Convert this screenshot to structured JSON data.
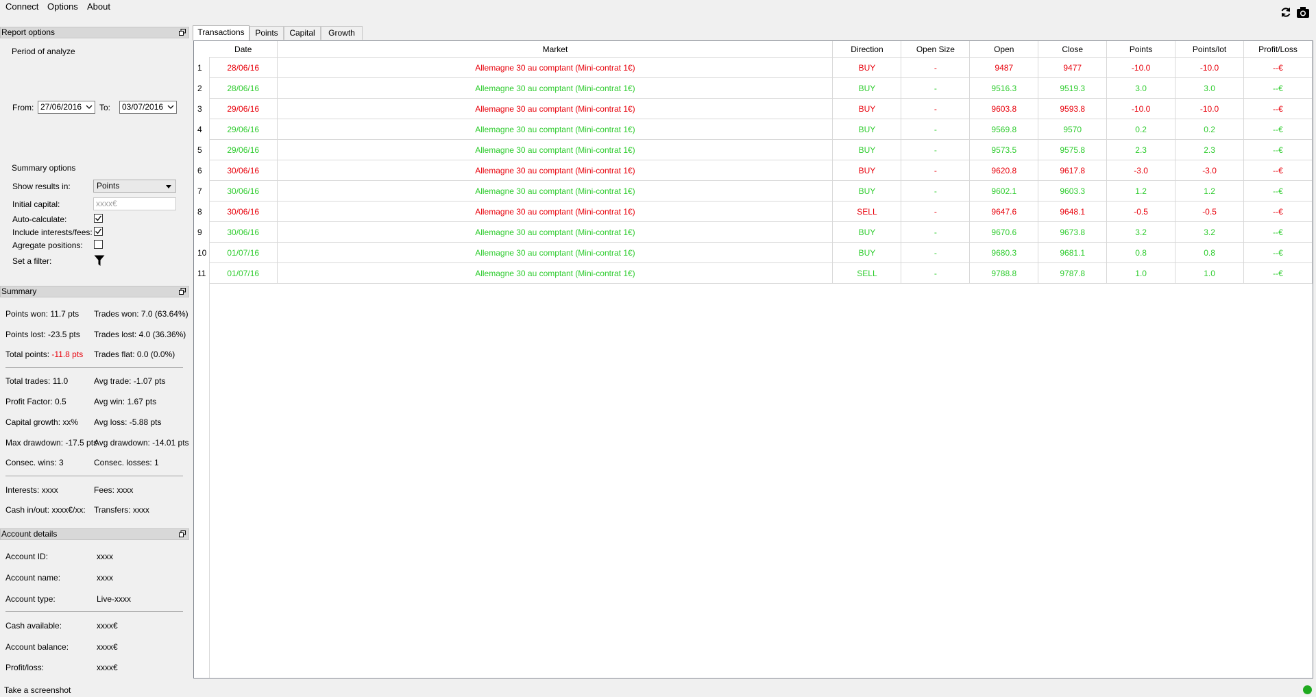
{
  "menu": {
    "items": [
      "Connect",
      "Options",
      "About"
    ]
  },
  "toolbar": {
    "refresh_icon": "refresh-icon",
    "screenshot_icon": "camera-icon"
  },
  "report_options": {
    "title": "Report options",
    "period_label": "Period of analyze",
    "from_label": "From:",
    "from_value": "27/06/2016",
    "to_label": "To:",
    "to_value": "03/07/2016",
    "summary_options_label": "Summary options",
    "show_results_label": "Show results in:",
    "show_results_value": "Points",
    "initial_capital_label": "Initial capital:",
    "initial_capital_placeholder": "xxxx€",
    "auto_calculate_label": "Auto-calculate:",
    "auto_calculate_checked": true,
    "include_fees_label": "Include interests/fees:",
    "include_fees_checked": true,
    "aggregate_label": "Agregate positions:",
    "aggregate_checked": false,
    "filter_label": "Set a filter:"
  },
  "summary": {
    "title": "Summary",
    "points_won": "Points won: 11.7 pts",
    "trades_won": "Trades won: 7.0 (63.64%)",
    "points_lost": "Points lost: -23.5 pts",
    "trades_lost": "Trades lost: 4.0 (36.36%)",
    "total_points_label": "Total points:",
    "total_points_value": "-11.8 pts",
    "trades_flat": "Trades flat: 0.0 (0.0%)",
    "total_trades": "Total trades: 11.0",
    "avg_trade": "Avg trade: -1.07 pts",
    "profit_factor": "Profit Factor: 0.5",
    "avg_win": "Avg win: 1.67 pts",
    "capital_growth": "Capital growth: xx%",
    "avg_loss": "Avg loss: -5.88 pts",
    "max_drawdown": "Max drawdown: -17.5 pts",
    "avg_drawdown": "Avg drawdown: -14.01 pts",
    "consec_wins": "Consec. wins: 3",
    "consec_losses": "Consec. losses: 1",
    "interests": "Interests: xxxx",
    "fees": "Fees: xxxx",
    "cash_in_out": "Cash in/out: xxxx€/xx:",
    "transfers": "Transfers: xxxx"
  },
  "account": {
    "title": "Account details",
    "id_label": "Account ID:",
    "id_value": "xxxx",
    "name_label": "Account name:",
    "name_value": "xxxx",
    "type_label": "Account type:",
    "type_value": "Live-xxxx",
    "cash_label": "Cash available:",
    "cash_value": "xxxx€",
    "balance_label": "Account balance:",
    "balance_value": "xxxx€",
    "pl_label": "Profit/loss:",
    "pl_value": "xxxx€"
  },
  "tabs": [
    "Transactions",
    "Points",
    "Capital",
    "Growth"
  ],
  "table": {
    "columns": [
      "Date",
      "Market",
      "Direction",
      "Open Size",
      "Open",
      "Close",
      "Points",
      "Points/lot",
      "Profit/Loss"
    ],
    "rows": [
      {
        "num": "1",
        "color": "red",
        "cells": [
          "28/06/16",
          "Allemagne 30 au comptant (Mini-contrat 1€)",
          "BUY",
          "-",
          "9487",
          "9477",
          "-10.0",
          "-10.0",
          "--€"
        ]
      },
      {
        "num": "2",
        "color": "green",
        "cells": [
          "28/06/16",
          "Allemagne 30 au comptant (Mini-contrat 1€)",
          "BUY",
          "-",
          "9516.3",
          "9519.3",
          "3.0",
          "3.0",
          "--€"
        ]
      },
      {
        "num": "3",
        "color": "red",
        "cells": [
          "29/06/16",
          "Allemagne 30 au comptant (Mini-contrat 1€)",
          "BUY",
          "-",
          "9603.8",
          "9593.8",
          "-10.0",
          "-10.0",
          "--€"
        ]
      },
      {
        "num": "4",
        "color": "green",
        "cells": [
          "29/06/16",
          "Allemagne 30 au comptant (Mini-contrat 1€)",
          "BUY",
          "-",
          "9569.8",
          "9570",
          "0.2",
          "0.2",
          "--€"
        ]
      },
      {
        "num": "5",
        "color": "green",
        "cells": [
          "29/06/16",
          "Allemagne 30 au comptant (Mini-contrat 1€)",
          "BUY",
          "-",
          "9573.5",
          "9575.8",
          "2.3",
          "2.3",
          "--€"
        ]
      },
      {
        "num": "6",
        "color": "red",
        "cells": [
          "30/06/16",
          "Allemagne 30 au comptant (Mini-contrat 1€)",
          "BUY",
          "-",
          "9620.8",
          "9617.8",
          "-3.0",
          "-3.0",
          "--€"
        ]
      },
      {
        "num": "7",
        "color": "green",
        "cells": [
          "30/06/16",
          "Allemagne 30 au comptant (Mini-contrat 1€)",
          "BUY",
          "-",
          "9602.1",
          "9603.3",
          "1.2",
          "1.2",
          "--€"
        ]
      },
      {
        "num": "8",
        "color": "red",
        "cells": [
          "30/06/16",
          "Allemagne 30 au comptant (Mini-contrat 1€)",
          "SELL",
          "-",
          "9647.6",
          "9648.1",
          "-0.5",
          "-0.5",
          "--€"
        ]
      },
      {
        "num": "9",
        "color": "green",
        "cells": [
          "30/06/16",
          "Allemagne 30 au comptant (Mini-contrat 1€)",
          "BUY",
          "-",
          "9670.6",
          "9673.8",
          "3.2",
          "3.2",
          "--€"
        ]
      },
      {
        "num": "10",
        "color": "green",
        "cells": [
          "01/07/16",
          "Allemagne 30 au comptant (Mini-contrat 1€)",
          "BUY",
          "-",
          "9680.3",
          "9681.1",
          "0.8",
          "0.8",
          "--€"
        ]
      },
      {
        "num": "11",
        "color": "green",
        "cells": [
          "01/07/16",
          "Allemagne 30 au comptant (Mini-contrat 1€)",
          "SELL",
          "-",
          "9788.8",
          "9787.8",
          "1.0",
          "1.0",
          "--€"
        ]
      }
    ]
  },
  "status": {
    "text": "Take a screenshot",
    "indicator_color": "#1faa1f"
  },
  "colors": {
    "loss": "#e8000b",
    "gain": "#2ecc2e"
  }
}
